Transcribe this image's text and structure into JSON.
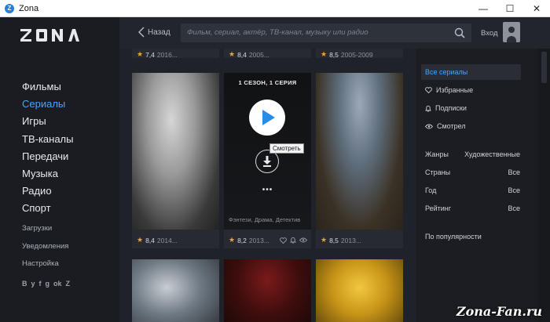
{
  "window": {
    "title": "Zona",
    "minimize": "—",
    "maximize": "☐",
    "close": "✕"
  },
  "logo": "ZONA",
  "nav": {
    "main": [
      "Фильмы",
      "Сериалы",
      "Игры",
      "ТВ-каналы",
      "Передачи",
      "Музыка",
      "Радио",
      "Спорт"
    ],
    "active_index": 1,
    "sub": [
      "Загрузки",
      "Уведомления",
      "Настройка"
    ],
    "social": [
      "B",
      "y",
      "f",
      "g",
      "ok",
      "Z"
    ]
  },
  "topbar": {
    "back_label": "Назад",
    "search_placeholder": "Фильм, сериал, актёр, ТВ-канал, музыку или радио",
    "login_label": "Вход"
  },
  "grid": {
    "row1": [
      {
        "rating": "7,4",
        "year": "2016..."
      },
      {
        "rating": "8,4",
        "year": "2005..."
      },
      {
        "rating": "8,5",
        "year": "2005-2009"
      }
    ],
    "row2": [
      {
        "rating": "8,4",
        "year": "2014..."
      },
      {
        "rating": "8,2",
        "year": "2013...",
        "season_label": "1 СЕЗОН, 1 СЕРИЯ",
        "watch_tooltip": "Смотреть",
        "more": "•••",
        "genres": "Фэнтези, Драма, Детектив"
      },
      {
        "rating": "8,5",
        "year": "2013..."
      }
    ]
  },
  "filters": {
    "all_series": "Все сериалы",
    "favorites": "Избранные",
    "subscriptions": "Подписки",
    "watched": "Смотрел",
    "rows": [
      {
        "label": "Жанры",
        "value": "Художественные"
      },
      {
        "label": "Страны",
        "value": "Все"
      },
      {
        "label": "Год",
        "value": "Все"
      },
      {
        "label": "Рейтинг",
        "value": "Все"
      }
    ],
    "sort": "По популярности"
  },
  "watermark": "Zona-Fan.ru",
  "colors": {
    "accent": "#4aa3ff",
    "star": "#e8a437",
    "play": "#2a8be8"
  }
}
